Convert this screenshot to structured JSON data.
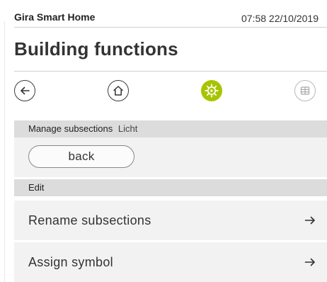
{
  "status_bar": {
    "brand": "Gira Smart Home",
    "datetime": "07:58 22/10/2019"
  },
  "header": {
    "title": "Building functions"
  },
  "nav": {
    "buttons": [
      {
        "icon": "back-arrow-icon",
        "active": false
      },
      {
        "icon": "home-icon",
        "active": false
      },
      {
        "icon": "settings-gear-icon",
        "active": true
      },
      {
        "icon": "grid-icon",
        "active": false
      }
    ],
    "active_color": "#a8c400"
  },
  "manage": {
    "label": "Manage subsections",
    "context": "Licht",
    "back_label": "back"
  },
  "edit": {
    "label": "Edit",
    "items": [
      {
        "label": "Rename subsections",
        "icon": "arrow-right-icon"
      },
      {
        "label": "Assign symbol",
        "icon": "arrow-right-icon"
      }
    ]
  }
}
